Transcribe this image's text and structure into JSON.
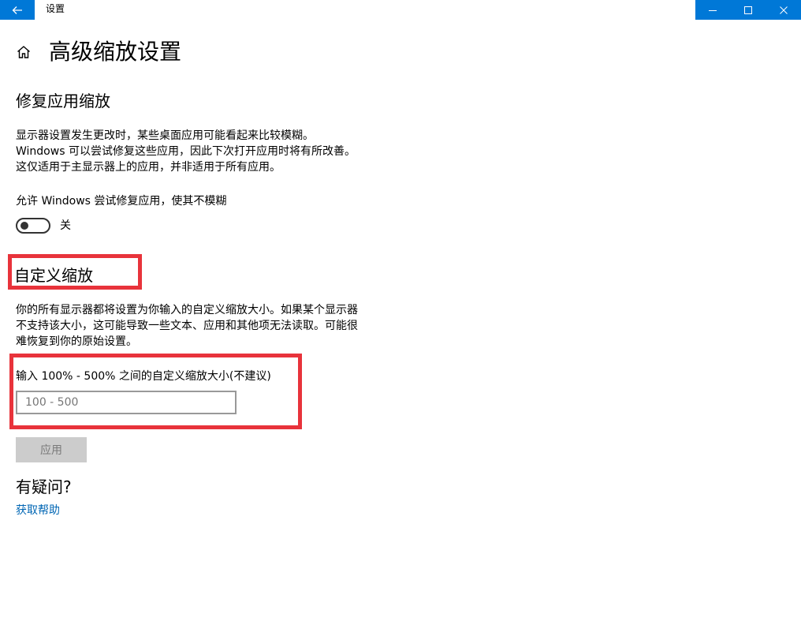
{
  "window": {
    "title": "设置",
    "accent_color": "#0078d7"
  },
  "page": {
    "title": "高级缩放设置"
  },
  "fix_scaling": {
    "heading": "修复应用缩放",
    "description": "显示器设置发生更改时，某些桌面应用可能看起来比较模糊。Windows 可以尝试修复这些应用，因此下次打开应用时将有所改善。这仅适用于主显示器上的应用，并非适用于所有应用。",
    "toggle_label": "允许 Windows 尝试修复应用，使其不模糊",
    "toggle_state": "关",
    "toggle_on": false
  },
  "custom_scaling": {
    "heading": "自定义缩放",
    "description": "你的所有显示器都将设置为你输入的自定义缩放大小。如果某个显示器不支持该大小，这可能导致一些文本、应用和其他项无法读取。可能很难恢复到你的原始设置。",
    "input_label": "输入 100% - 500% 之间的自定义缩放大小(不建议)",
    "input_placeholder": "100 - 500",
    "input_value": "",
    "apply_label": "应用",
    "highlight_color": "#e8333b"
  },
  "help": {
    "heading": "有疑问?",
    "link_label": "获取帮助",
    "link_color": "#0066b4"
  },
  "icons": {
    "back": "arrow-left-icon",
    "home": "home-icon",
    "minimize": "minimize-icon",
    "maximize": "maximize-icon",
    "close": "close-icon"
  }
}
